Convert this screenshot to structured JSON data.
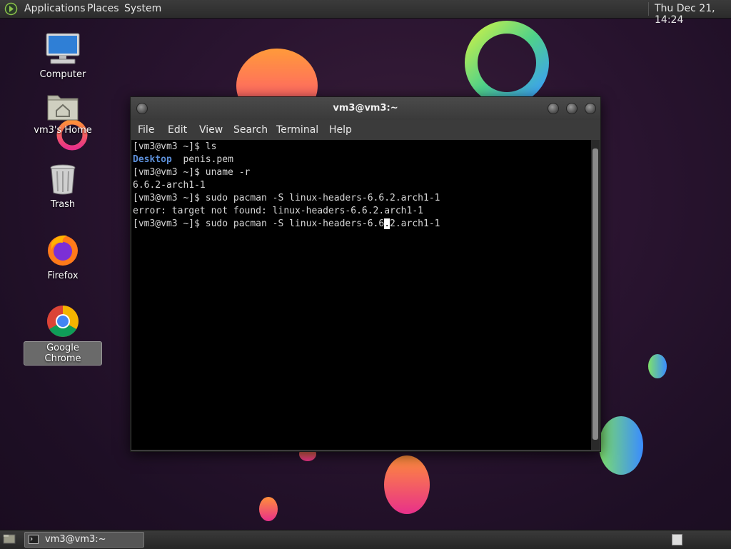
{
  "top_panel": {
    "menus": [
      "Applications",
      "Places",
      "System"
    ],
    "clock": "Thu Dec 21, 14:24"
  },
  "desktop": {
    "icons": [
      {
        "label": "Computer",
        "icon": "computer-icon"
      },
      {
        "label": "vm3's Home",
        "icon": "home-folder-icon"
      },
      {
        "label": "Trash",
        "icon": "trash-icon"
      },
      {
        "label": "Firefox",
        "icon": "firefox-icon"
      },
      {
        "label": "Google Chrome",
        "icon": "chrome-icon",
        "selected": true
      }
    ]
  },
  "terminal": {
    "title": "vm3@vm3:~",
    "menu": [
      "File",
      "Edit",
      "View",
      "Search",
      "Terminal",
      "Help"
    ],
    "lines": [
      "[vm3@vm3 ~]$ ls",
      "penis.pem",
      "[vm3@vm3 ~]$ uname -r",
      "6.6.2-arch1-1",
      "[vm3@vm3 ~]$ sudo pacman -S linux-headers-6.6.2.arch1-1",
      "error: target not found: linux-headers-6.6.2.arch1-1"
    ],
    "dir_entry": "Desktop",
    "current_prompt_before": "[vm3@vm3 ~]$ sudo pacman -S linux-headers-6.6",
    "cursor_char": ".",
    "current_prompt_after": "2.arch1-1"
  },
  "bottom_panel": {
    "task_label": "vm3@vm3:~"
  },
  "colors": {
    "background": "#24122a",
    "panel": "#2f2f2f",
    "directory": "#5c8fd8"
  }
}
